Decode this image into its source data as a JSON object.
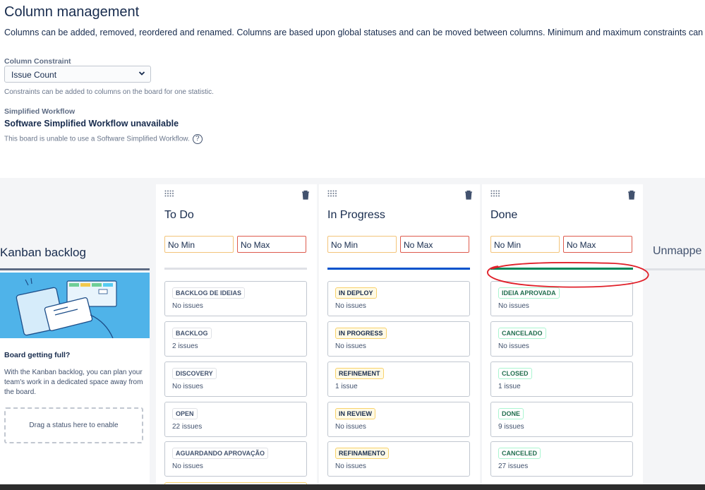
{
  "header": {
    "title": "Column management",
    "description": "Columns can be added, removed, reordered and renamed. Columns are based upon global statuses and can be moved between columns. Minimum and maximum constraints can be set for each"
  },
  "constraint": {
    "label": "Column Constraint",
    "selected": "Issue Count",
    "help": "Constraints can be added to columns on the board for one statistic."
  },
  "workflow": {
    "label": "Simplified Workflow",
    "status": "Software Simplified Workflow unavailable",
    "help": "This board is unable to use a Software Simplified Workflow.",
    "help_icon": "?"
  },
  "backlog": {
    "title": "Kanban backlog",
    "question": "Board getting full?",
    "text": "With the Kanban backlog, you can plan your team's work in a dedicated space away from the board.",
    "drop_hint": "Drag a status here to enable"
  },
  "columns": [
    {
      "name": "To Do",
      "min": "No Min",
      "max": "No Max",
      "bar_color": "#dfe1e6",
      "statuses": [
        {
          "name": "BACKLOG DE IDEIAS",
          "count": "No issues",
          "style": "grey"
        },
        {
          "name": "BACKLOG",
          "count": "2 issues",
          "style": "grey"
        },
        {
          "name": "DISCOVERY",
          "count": "No issues",
          "style": "grey"
        },
        {
          "name": "OPEN",
          "count": "22 issues",
          "style": "grey"
        },
        {
          "name": "AGUARDANDO APROVAÇÃO",
          "count": "No issues",
          "style": "grey"
        }
      ]
    },
    {
      "name": "In Progress",
      "min": "No Min",
      "max": "No Max",
      "bar_color": "#0052cc",
      "statuses": [
        {
          "name": "IN DEPLOY",
          "count": "No issues",
          "style": "yellow"
        },
        {
          "name": "IN PROGRESS",
          "count": "No issues",
          "style": "yellow"
        },
        {
          "name": "REFINEMENT",
          "count": "1 issue",
          "style": "yellow"
        },
        {
          "name": "IN REVIEW",
          "count": "No issues",
          "style": "yellow"
        },
        {
          "name": "REFINAMENTO",
          "count": "No issues",
          "style": "yellow"
        }
      ]
    },
    {
      "name": "Done",
      "min": "No Min",
      "max": "No Max",
      "bar_color": "#00875a",
      "statuses": [
        {
          "name": "IDEIA APROVADA",
          "count": "No issues",
          "style": "green"
        },
        {
          "name": "CANCELADO",
          "count": "No issues",
          "style": "green"
        },
        {
          "name": "CLOSED",
          "count": "1 issue",
          "style": "green"
        },
        {
          "name": "DONE",
          "count": "9 issues",
          "style": "green"
        },
        {
          "name": "CANCELED",
          "count": "27 issues",
          "style": "green"
        }
      ]
    }
  ],
  "unmapped": {
    "title": "Unmappe"
  },
  "icons": {
    "drag": "drag-handle-icon",
    "delete": "trash-icon",
    "dropdown": "chevron-down-icon",
    "help": "question-circle-icon"
  },
  "colors": {
    "annotation": "#e0202a"
  }
}
